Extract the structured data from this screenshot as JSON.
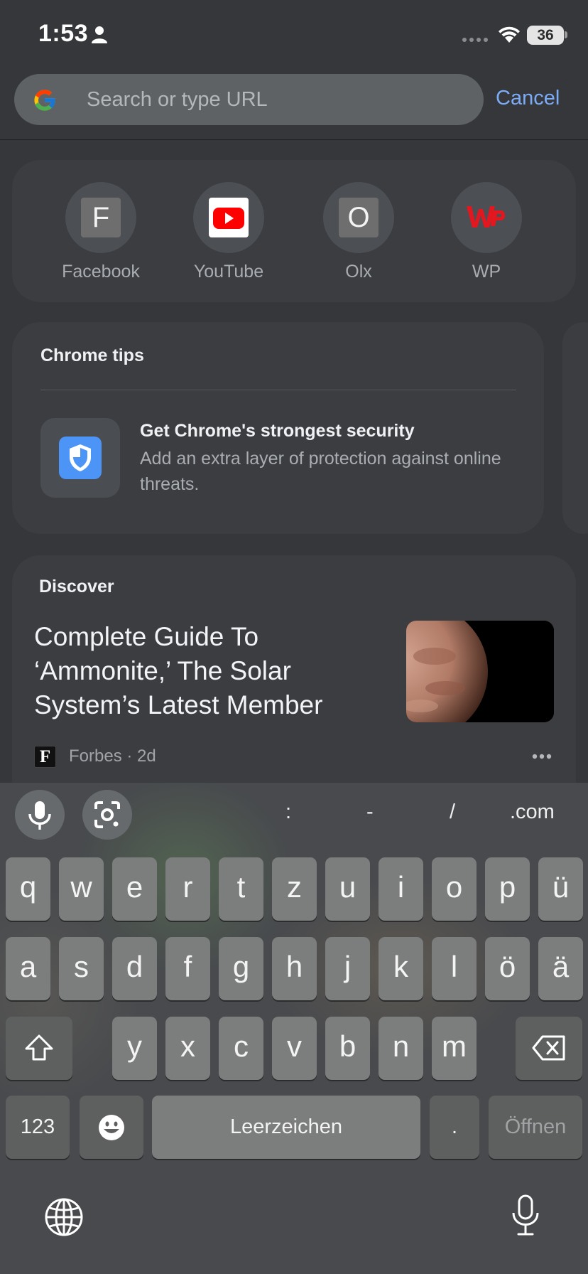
{
  "status_bar": {
    "time": "1:53",
    "battery": "36"
  },
  "omnibox": {
    "placeholder": "Search or type URL",
    "cancel_label": "Cancel"
  },
  "shortcuts": [
    {
      "label": "Facebook",
      "letter": "F",
      "icon": "letter-tile"
    },
    {
      "label": "YouTube",
      "icon": "youtube-icon"
    },
    {
      "label": "Olx",
      "letter": "O",
      "icon": "letter-tile"
    },
    {
      "label": "WP",
      "icon": "wp-logo"
    }
  ],
  "tips": {
    "title": "Chrome tips",
    "heading": "Get Chrome's strongest security",
    "description": "Add an extra layer of protection against online threats.",
    "icon": "shield-icon"
  },
  "discover": {
    "label": "Discover",
    "article": {
      "title": "Complete Guide To ‘Ammonite,’ The Solar System’s Latest Member",
      "source_logo": "F",
      "meta": "Forbes · 2d"
    }
  },
  "keyboard": {
    "toolbar_symbols": [
      ":",
      "-",
      "/",
      ".com"
    ],
    "row1": [
      "q",
      "w",
      "e",
      "r",
      "t",
      "z",
      "u",
      "i",
      "o",
      "p",
      "ü"
    ],
    "row2": [
      "a",
      "s",
      "d",
      "f",
      "g",
      "h",
      "j",
      "k",
      "l",
      "ö",
      "ä"
    ],
    "row3": [
      "y",
      "x",
      "c",
      "v",
      "b",
      "n",
      "m"
    ],
    "numbers_label": "123",
    "space_label": "Leerzeichen",
    "period_label": ".",
    "go_label": "Öffnen"
  },
  "colors": {
    "accent": "#7cacf8",
    "background": "#35373a",
    "card": "#3b3d41",
    "youtube_red": "#ff0000",
    "wp_red": "#e3171f",
    "shield_blue": "#4c94f5"
  }
}
